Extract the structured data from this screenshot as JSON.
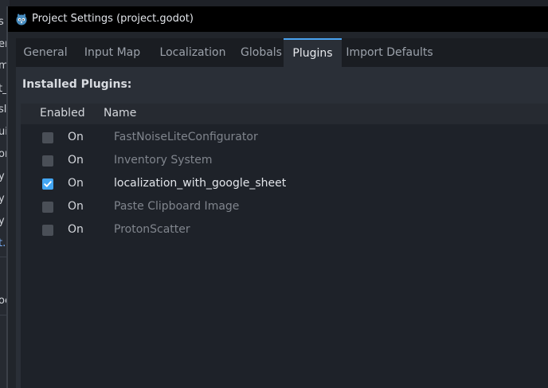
{
  "background_fragments": [
    "s",
    "er",
    "m",
    "t_",
    "sl",
    "ui",
    "or",
    "y",
    "y",
    "y",
    "t.",
    "oc"
  ],
  "window": {
    "title": "Project Settings (project.godot)"
  },
  "tabs": [
    {
      "label": "General"
    },
    {
      "label": "Input Map"
    },
    {
      "label": "Localization"
    },
    {
      "label": "Globals"
    },
    {
      "label": "Plugins"
    },
    {
      "label": "Import Defaults"
    }
  ],
  "plugins": {
    "section_title": "Installed Plugins:",
    "columns": {
      "enabled": "Enabled",
      "name": "Name"
    },
    "rows": [
      {
        "on_label": "On",
        "name": "FastNoiseLiteConfigurator",
        "enabled": false
      },
      {
        "on_label": "On",
        "name": "Inventory System",
        "enabled": false
      },
      {
        "on_label": "On",
        "name": "localization_with_google_sheet",
        "enabled": true
      },
      {
        "on_label": "On",
        "name": "Paste Clipboard Image",
        "enabled": false
      },
      {
        "on_label": "On",
        "name": "ProtonScatter",
        "enabled": false
      }
    ]
  },
  "colors": {
    "accent": "#43a6f2",
    "titlebar": "#000000",
    "panel": "#2a2f37"
  }
}
